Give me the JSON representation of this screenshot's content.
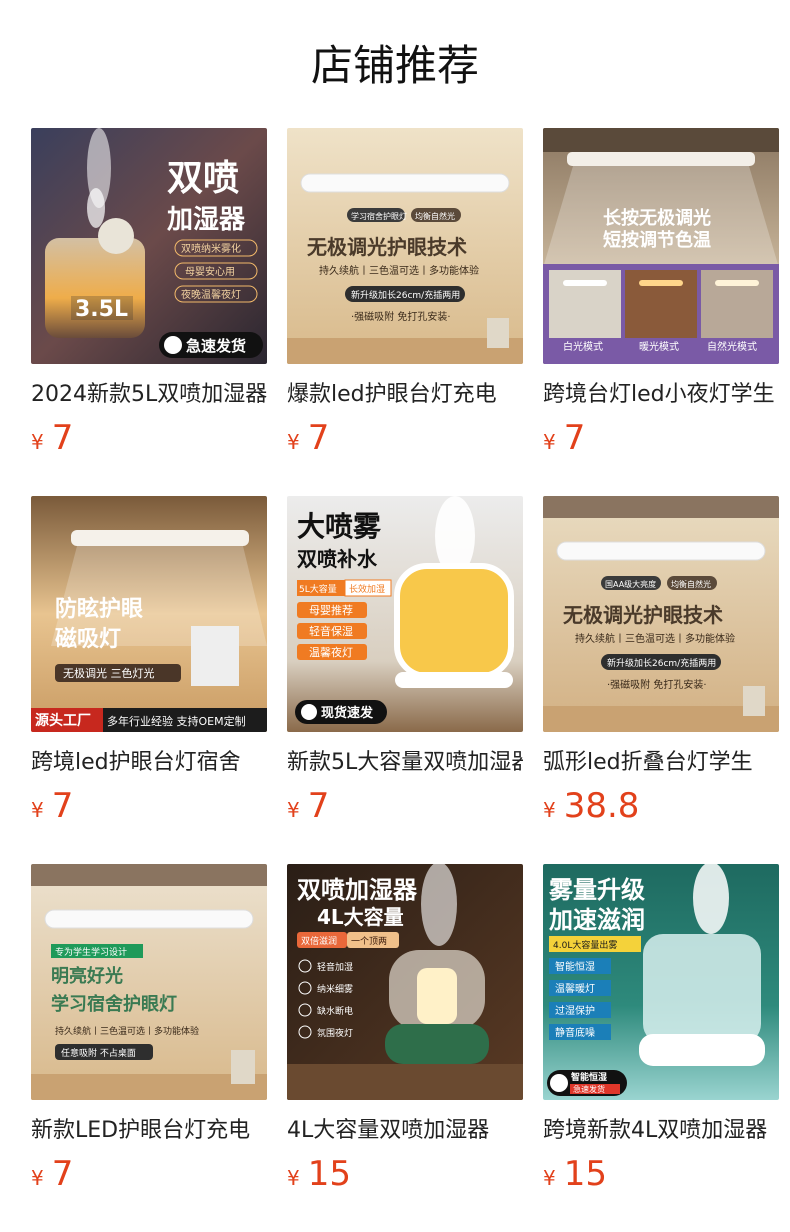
{
  "header": {
    "title": "店铺推荐"
  },
  "currency": "¥",
  "products": [
    {
      "name": "2024新款5L双喷加湿器",
      "price": "7",
      "image_text": {
        "headline1": "双喷",
        "headline2": "加湿器",
        "tags": [
          "双喷纳米雾化",
          "母婴安心用",
          "夜晚温馨夜灯"
        ],
        "capacity": "3.5L",
        "badge": "急速发货"
      }
    },
    {
      "name": "爆款led护眼台灯充电",
      "price": "7",
      "image_text": {
        "top_tags": [
          "学习宿舍护眼灯",
          "均衡自然光"
        ],
        "headline": "无极调光护眼技术",
        "features": "持久续航丨三色温可选丨多功能体验",
        "pill": "新升级加长26cm/充插两用",
        "footer": "·强磁吸附  免打孔安装·"
      }
    },
    {
      "name": "跨境台灯led小夜灯学生",
      "price": "7",
      "image_text": {
        "headline1": "长按无极调光",
        "headline2": "短按调节色温",
        "modes": [
          "白光模式",
          "暖光模式",
          "自然光模式"
        ]
      }
    },
    {
      "name": "跨境led护眼台灯宿舍",
      "price": "7",
      "image_text": {
        "headline1": "防眩护眼",
        "headline2": "磁吸灯",
        "sub": "无极调光 三色灯光",
        "banner_left": "源头工厂",
        "banner_right": "多年行业经验 支持OEM定制"
      }
    },
    {
      "name": "新款5L大容量双喷加湿器",
      "price": "7",
      "image_text": {
        "headline1": "大喷雾",
        "headline2": "双喷补水",
        "tag_a": "5L大容量",
        "tag_b": "长效加湿",
        "tags": [
          "母婴推荐",
          "轻音保湿",
          "温馨夜灯"
        ],
        "badge": "现货速发"
      }
    },
    {
      "name": "弧形led折叠台灯学生",
      "price": "38.8",
      "image_text": {
        "top_tags": [
          "国AA级大亮度",
          "均衡自然光"
        ],
        "headline": "无极调光护眼技术",
        "features": "持久续航丨三色温可选丨多功能体验",
        "pill": "新升级加长26cm/充插两用",
        "footer": "·强磁吸附  免打孔安装·"
      }
    },
    {
      "name": "新款LED护眼台灯充电",
      "price": "7",
      "image_text": {
        "tag": "专为学生学习设计",
        "headline1": "明亮好光",
        "headline2": "学习宿舍护眼灯",
        "features": "持久续航丨三色温可选丨多功能体验",
        "footer": "任意吸附 不占桌面"
      }
    },
    {
      "name": "4L大容量双喷加湿器",
      "price": "15",
      "image_text": {
        "headline1": "双喷加湿器",
        "headline2": "4L大容量",
        "tag_a": "双倍滋润",
        "tag_b": "一个顶两",
        "features": [
          "轻音加湿",
          "纳米细雾",
          "缺水断电",
          "氛围夜灯"
        ]
      }
    },
    {
      "name": "跨境新款4L双喷加湿器",
      "price": "15",
      "image_text": {
        "headline1": "雾量升级",
        "headline2": "加速滋润",
        "tag": "4.0L大容量出雾",
        "features": [
          "智能恒湿",
          "温馨暖灯",
          "过湿保护",
          "静音底噪"
        ],
        "badge1": "智能恒湿",
        "badge2": "急速发货"
      }
    }
  ]
}
